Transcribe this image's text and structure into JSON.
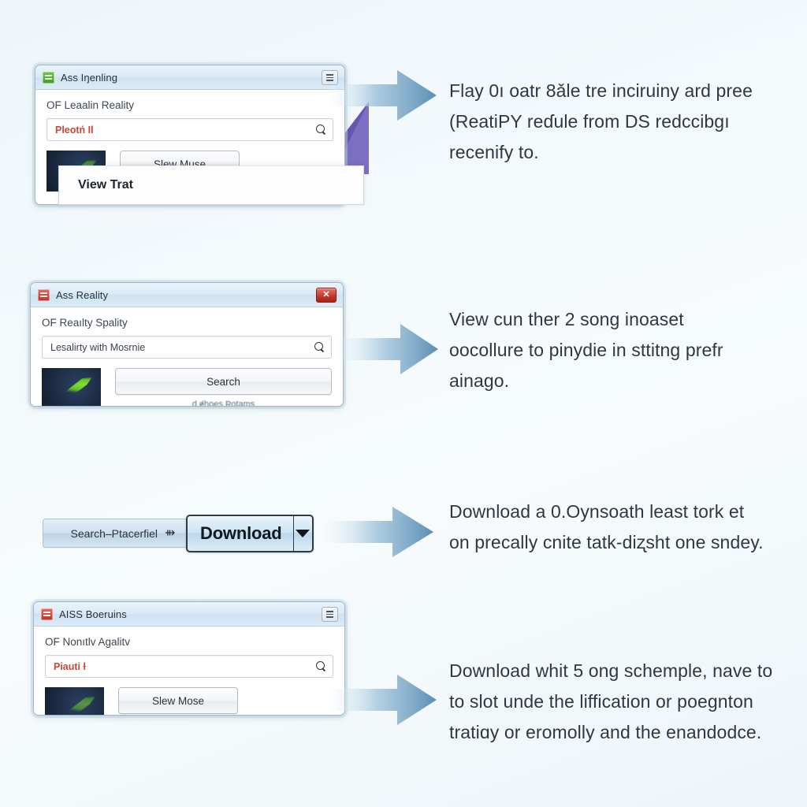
{
  "background": {
    "accent_blue": "#5b8fb5",
    "accent_purple": "#6b5fbe",
    "page_bg": "#f2f8fa"
  },
  "steps": [
    {
      "id": "step-1",
      "window": {
        "title": "Ass Iŋenling",
        "icon": "app-icon-green",
        "titlebar_button": "minimize-button",
        "section_label": "OF  Leaаlin Reality",
        "search_value": "Pleotń Il",
        "search_icon": "search-icon",
        "action_button": "Slew Muse",
        "overlay_label": "View Trat"
      },
      "arrow": "arrow-right-icon",
      "caption": "Flay 0ı oatr 8ǎle tre inciruiny ard pree (ReatiPY reɗule from DS redccibgı recenify to."
    },
    {
      "id": "step-2",
      "window": {
        "title": "Ass Reality",
        "icon": "app-icon-red",
        "titlebar_button": "close-button",
        "titlebar_button_glyph": "✕",
        "section_label": "OF  Reaılty Spality",
        "search_value": "Lesalirty with Mosrnie",
        "search_icon": "search-icon",
        "action_button": "Search",
        "sub_caption": "ɖ ɇhoes Ʀotams"
      },
      "arrow": "arrow-right-icon",
      "caption": "View cun ther 2 song inoaset oocollure to pinydie in sttitng prefr ainago."
    },
    {
      "id": "step-3",
      "controls": {
        "pill_label": "Search–Ptacerfiel",
        "pill_arrow_glyph": "⇻",
        "download_label": "Download",
        "download_caret": "chevron-down-icon"
      },
      "arrow": "arrow-right-icon",
      "caption": "Download a 0.Oynsoath least tork et on precally cnite tatk-diʐsht one sndey."
    },
    {
      "id": "step-4",
      "window": {
        "title": "AISS Boeruins",
        "icon": "app-icon-red",
        "titlebar_button": "dropdown-button",
        "section_label": "OF  Nonıtlv Agalitv",
        "search_value": "Piauti ƚ",
        "search_icon": "search-icon",
        "action_button": "Slew Mose"
      },
      "arrow": "arrow-right-icon",
      "caption": "Download whit 5 ong schemple, nave to to slot unde the liffication or poegnton tratiɑy or eromolly and the enandodce."
    }
  ]
}
